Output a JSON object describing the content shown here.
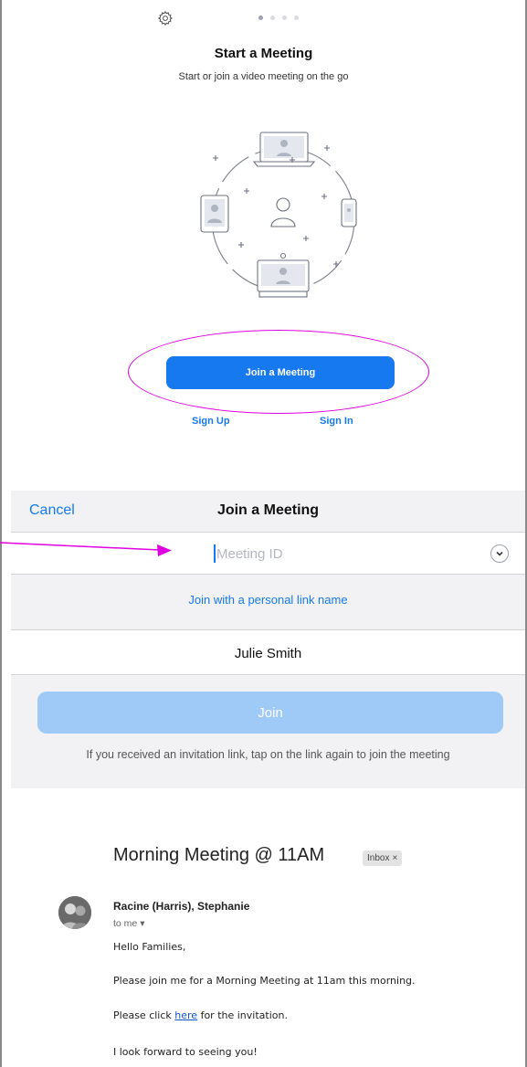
{
  "start_screen": {
    "title": "Start a Meeting",
    "subtitle": "Start or join a video meeting on the go",
    "join_button": "Join a Meeting",
    "sign_up": "Sign Up",
    "sign_in": "Sign In",
    "page_indicator": {
      "pages": 4,
      "active": 1
    },
    "accent_color": "#1779f0",
    "highlight_color": "#e000e0"
  },
  "join_dialog": {
    "cancel_label": "Cancel",
    "title": "Join a Meeting",
    "meeting_id_placeholder": "Meeting ID",
    "personal_link_label": "Join with a personal link name",
    "name_value": "Julie Smith",
    "join_button": "Join",
    "invite_note": "If you received an invitation link, tap on the link again to join the meeting"
  },
  "email": {
    "subject": "Morning Meeting @ 11AM",
    "label_badge": "Inbox",
    "label_close": "×",
    "sender": "Racine (Harris), Stephanie",
    "recipient": "to me",
    "greeting": "Hello Families,",
    "body_line1": "Please join me for a Morning Meeting at 11am this morning.",
    "body_line2_pre": "Please click ",
    "body_line2_link": "here",
    "body_line2_post": " for the invitation.",
    "closing": "I look forward to seeing you!"
  }
}
